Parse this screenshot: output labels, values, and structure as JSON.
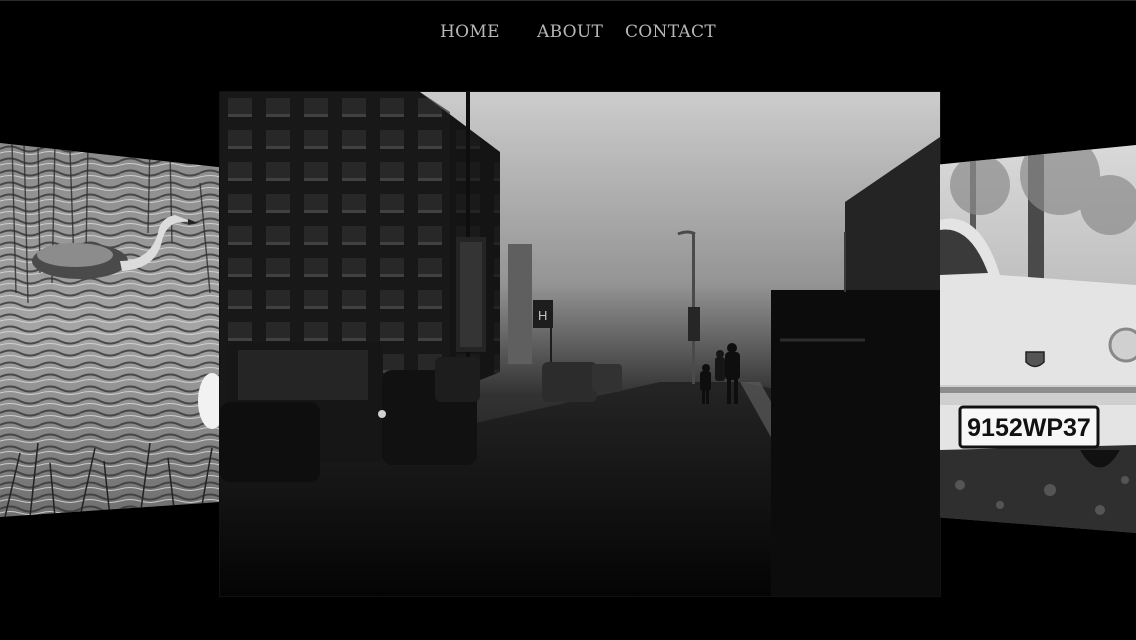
{
  "nav": {
    "items": [
      {
        "label": "HOME"
      },
      {
        "label": "ABOUT"
      },
      {
        "label": "CONTACT"
      }
    ]
  },
  "carousel": {
    "center_slide": {
      "bus_stop_sign": "H"
    },
    "right_slide": {
      "license_plate": "9152WP37"
    }
  },
  "colors": {
    "background": "#000000",
    "nav_text": "#b7b7b7"
  },
  "icons": {
    "car_badge": "crest-badge-icon"
  }
}
